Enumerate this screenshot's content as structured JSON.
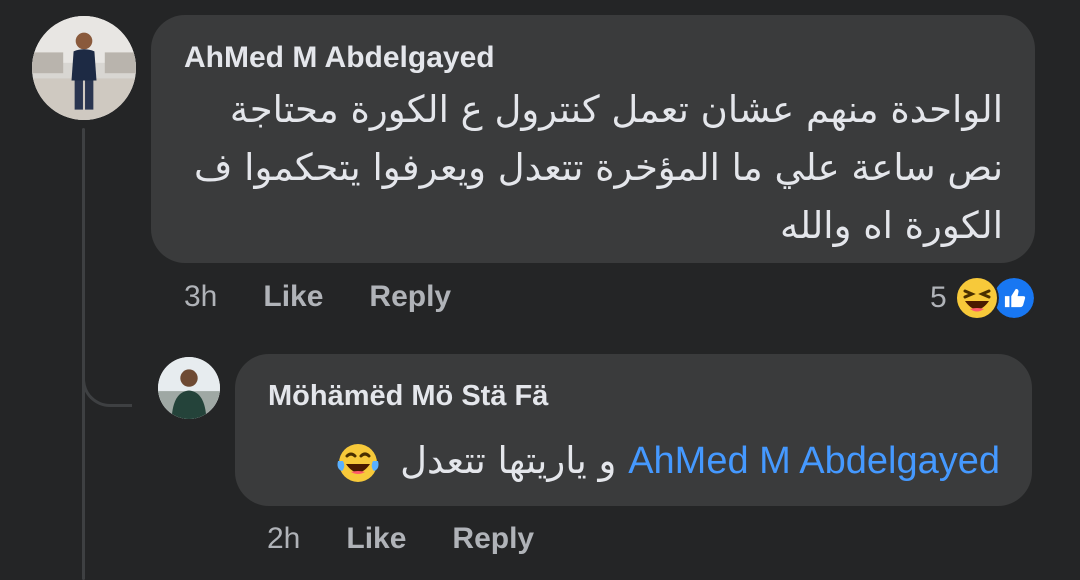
{
  "comment": {
    "author": "AhMed M Abdelgayed",
    "text": "الواحدة منهم عشان تعمل كنترول ع الكورة محتاجة نص ساعة علي ما المؤخرة تتعدل ويعرفوا يتحكموا ف الكورة اه والله",
    "time": "3h",
    "like_label": "Like",
    "reply_label": "Reply",
    "reaction_count": "5",
    "reaction_icons": [
      "laughing-face-icon",
      "thumbs-up-icon"
    ]
  },
  "reply": {
    "author": "Möhämëd Mö Stä Fä",
    "mention": "AhMed M Abdelgayed",
    "text": "و ياريتها تتعدل",
    "emoji": "tears-of-joy-icon",
    "time": "2h",
    "like_label": "Like",
    "reply_label": "Reply"
  },
  "colors": {
    "background": "#242526",
    "bubble": "#3a3b3c",
    "mention": "#4599ff",
    "like_blue": "#1877f2",
    "muted_text": "#b0b3b8"
  }
}
